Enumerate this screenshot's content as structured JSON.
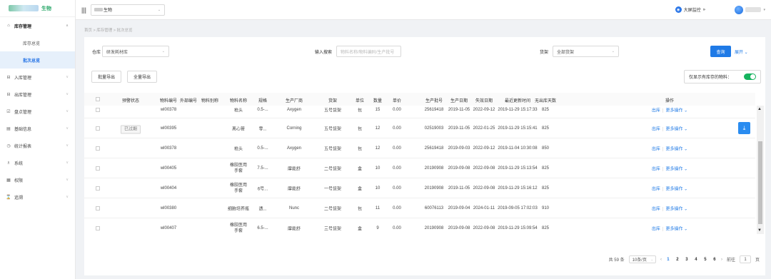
{
  "brand": {
    "name": "生物"
  },
  "topbar": {
    "company": "生物",
    "monitor_label": "大屏监控",
    "monitor_arrow": "»"
  },
  "sidebar": {
    "items": [
      {
        "icon": "⌂",
        "label": "库存管理",
        "open": true
      },
      {
        "label": "库存总览",
        "sub": true
      },
      {
        "label": "批次总览",
        "sub": true,
        "active": true
      },
      {
        "icon": "⊟",
        "label": "入库管理"
      },
      {
        "icon": "⊟",
        "label": "出库管理"
      },
      {
        "icon": "☑",
        "label": "盘点管理"
      },
      {
        "icon": "▤",
        "label": "基础信息"
      },
      {
        "icon": "◷",
        "label": "统计报表"
      },
      {
        "icon": "♗",
        "label": "系统"
      },
      {
        "icon": "▦",
        "label": "权限"
      },
      {
        "icon": "⌛",
        "label": "追溯"
      }
    ]
  },
  "breadcrumb": "首页 > 库存管理 > 批次总览",
  "filters": {
    "warehouse_label": "仓库",
    "warehouse_value": "研发耗材库",
    "search_label": "输入搜索",
    "search_placeholder": "物料名称/物料编码/生产批号",
    "shelf_label": "货架",
    "shelf_value": "全部货架",
    "query_button": "查询",
    "expand_label": "展开 ⌄"
  },
  "actions": {
    "batch_export": "批量导出",
    "export_all": "全量导出",
    "only_in_stock": "仅显示有库存的物料："
  },
  "table": {
    "columns": [
      "预警状态",
      "物料编号",
      "外部编号",
      "物料别称",
      "物料名称",
      "规格",
      "生产厂商",
      "货架",
      "单位",
      "数量",
      "单价",
      "生产批号",
      "生产日期",
      "失效日期",
      "最近更新时间",
      "无出库天数",
      "操作"
    ],
    "rows": [
      {
        "status": "",
        "code": "wl00378",
        "name": "枪头",
        "spec": "0.5-...",
        "maker": "Axygen",
        "shelf": "五号货架",
        "unit": "包",
        "qty": "15",
        "price": "0.00",
        "lot": "25619418",
        "mfg": "2019-11-05",
        "exp": "2022-09-12",
        "updated": "2019-11-29 15:17:33",
        "days": "825"
      },
      {
        "status": "已过期",
        "code": "wl00395",
        "name": "离心管",
        "spec": "零...",
        "maker": "Corning",
        "shelf": "五号货架",
        "unit": "包",
        "qty": "12",
        "price": "0.00",
        "lot": "02519003",
        "mfg": "2019-11-05",
        "exp": "2022-01-25",
        "updated": "2019-11-29 15:15:41",
        "days": "825"
      },
      {
        "status": "",
        "code": "wl00378",
        "name": "枪头",
        "spec": "0.5-...",
        "maker": "Axygen",
        "shelf": "五号货架",
        "unit": "包",
        "qty": "12",
        "price": "0.00",
        "lot": "25619418",
        "mfg": "2019-09-03",
        "exp": "2022-09-12",
        "updated": "2019-11-04 10:30:08",
        "days": "850"
      },
      {
        "status": "",
        "code": "wl00405",
        "name": "橡胶医用手套",
        "spec": "7.5-...",
        "maker": "摩能舒",
        "shelf": "二号货架",
        "unit": "盒",
        "qty": "10",
        "price": "0.00",
        "lot": "20190908",
        "mfg": "2019-09-08",
        "exp": "2022-09-08",
        "updated": "2019-11-29 15:13:54",
        "days": "825"
      },
      {
        "status": "",
        "code": "wl00404",
        "name": "橡胶医用手套",
        "spec": "6号...",
        "maker": "摩能舒",
        "shelf": "一号货架",
        "unit": "盒",
        "qty": "10",
        "price": "0.00",
        "lot": "20190908",
        "mfg": "2019-11-05",
        "exp": "2022-09-08",
        "updated": "2019-11-29 15:16:12",
        "days": "825"
      },
      {
        "status": "",
        "code": "wl00380",
        "name": "细胞培养瓶",
        "spec": "透...",
        "maker": "Nunc",
        "shelf": "二号货架",
        "unit": "包",
        "qty": "11",
        "price": "0.00",
        "lot": "60076113",
        "mfg": "2019-09-04",
        "exp": "2024-01-11",
        "updated": "2019-09-05 17:02:03",
        "days": "910"
      },
      {
        "status": "",
        "code": "wl00407",
        "name": "橡胶医用手套",
        "spec": "6.5-...",
        "maker": "摩能舒",
        "shelf": "三号货架",
        "unit": "盒",
        "qty": "9",
        "price": "0.00",
        "lot": "20190908",
        "mfg": "2019-09-08",
        "exp": "2022-09-08",
        "updated": "2019-11-29 15:09:54",
        "days": "825"
      }
    ],
    "op_out": "出库",
    "op_more": "更多操作 ⌄"
  },
  "pagination": {
    "total": "共 59 条",
    "page_size": "10条/页",
    "pages": [
      "1",
      "2",
      "3",
      "4",
      "5",
      "6"
    ],
    "current": "1",
    "goto_label": "前往",
    "goto_value": "1",
    "page_suffix": "页"
  }
}
